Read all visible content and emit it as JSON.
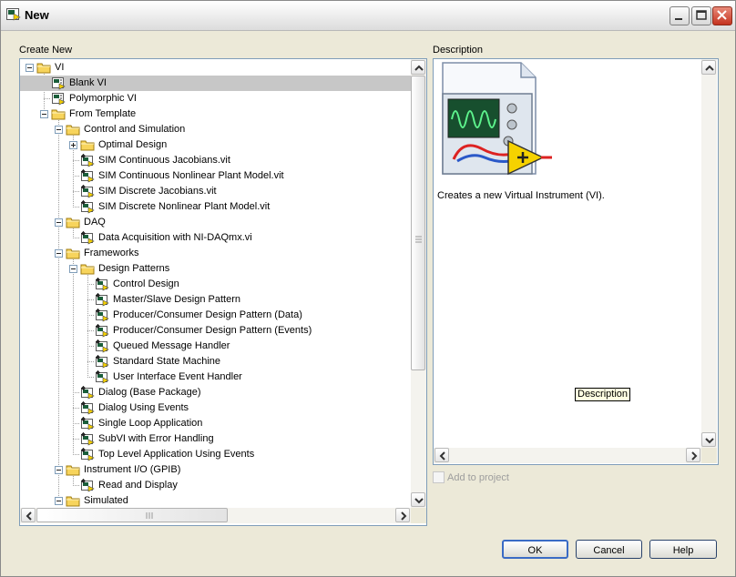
{
  "window": {
    "title": "New"
  },
  "left_panel": {
    "label": "Create New"
  },
  "tree": [
    {
      "label": "VI",
      "level": 0,
      "type": "folder",
      "expander": "minus"
    },
    {
      "label": "Blank VI",
      "level": 1,
      "type": "vi",
      "selected": true
    },
    {
      "label": "Polymorphic VI",
      "level": 1,
      "type": "vi"
    },
    {
      "label": "From Template",
      "level": 1,
      "type": "folder",
      "expander": "minus"
    },
    {
      "label": "Control and Simulation",
      "level": 2,
      "type": "folder",
      "expander": "minus"
    },
    {
      "label": "Optimal Design",
      "level": 3,
      "type": "folder",
      "expander": "plus"
    },
    {
      "label": "SIM Continuous Jacobians.vit",
      "level": 3,
      "type": "template"
    },
    {
      "label": "SIM Continuous Nonlinear Plant Model.vit",
      "level": 3,
      "type": "template"
    },
    {
      "label": "SIM Discrete Jacobians.vit",
      "level": 3,
      "type": "template"
    },
    {
      "label": "SIM Discrete Nonlinear Plant Model.vit",
      "level": 3,
      "type": "template"
    },
    {
      "label": "DAQ",
      "level": 2,
      "type": "folder",
      "expander": "minus"
    },
    {
      "label": "Data Acquisition with NI-DAQmx.vi",
      "level": 3,
      "type": "template"
    },
    {
      "label": "Frameworks",
      "level": 2,
      "type": "folder",
      "expander": "minus"
    },
    {
      "label": "Design Patterns",
      "level": 3,
      "type": "folder",
      "expander": "minus"
    },
    {
      "label": "Control Design",
      "level": 4,
      "type": "template"
    },
    {
      "label": "Master/Slave Design Pattern",
      "level": 4,
      "type": "template"
    },
    {
      "label": "Producer/Consumer Design Pattern (Data)",
      "level": 4,
      "type": "template"
    },
    {
      "label": "Producer/Consumer Design Pattern (Events)",
      "level": 4,
      "type": "template"
    },
    {
      "label": "Queued Message Handler",
      "level": 4,
      "type": "template"
    },
    {
      "label": "Standard State Machine",
      "level": 4,
      "type": "template"
    },
    {
      "label": "User Interface Event Handler",
      "level": 4,
      "type": "template"
    },
    {
      "label": "Dialog (Base Package)",
      "level": 3,
      "type": "template"
    },
    {
      "label": "Dialog Using Events",
      "level": 3,
      "type": "template"
    },
    {
      "label": "Single Loop Application",
      "level": 3,
      "type": "template"
    },
    {
      "label": "SubVI with Error Handling",
      "level": 3,
      "type": "template"
    },
    {
      "label": "Top Level Application Using Events",
      "level": 3,
      "type": "template"
    },
    {
      "label": "Instrument I/O (GPIB)",
      "level": 2,
      "type": "folder",
      "expander": "minus"
    },
    {
      "label": "Read and Display",
      "level": 3,
      "type": "template"
    },
    {
      "label": "Simulated",
      "level": 2,
      "type": "folder",
      "expander": "minus"
    }
  ],
  "description": {
    "label": "Description",
    "text": "Creates a new Virtual Instrument (VI).",
    "tooltip": "Description"
  },
  "add_to_project": {
    "label": "Add to project",
    "checked": false,
    "enabled": false
  },
  "buttons": {
    "ok": "OK",
    "cancel": "Cancel",
    "help": "Help"
  },
  "colors": {
    "selection": "#c7c7c7",
    "panel_border": "#7f9db9",
    "dialog_bg": "#ece9d8",
    "folder": "#f7d45c"
  }
}
